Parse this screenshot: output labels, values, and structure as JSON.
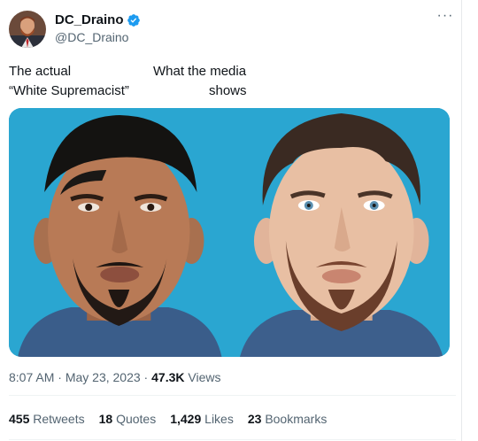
{
  "author": {
    "display_name": "DC_Draino",
    "handle": "@DC_Draino",
    "verified": true,
    "verified_color": "#1d9bf0",
    "avatar_icon": "profile-photo"
  },
  "more_icon": "more-options-icon",
  "tweet": {
    "line1_left": "The actual",
    "line2_left": "“White Supremacist”",
    "line1_right": "What the media",
    "line2_right": "shows"
  },
  "media": {
    "background": "#2aa6d1",
    "left_photo": "mugshot-photo-left",
    "right_photo": "mugshot-photo-right"
  },
  "meta": {
    "time": "8:07 AM",
    "separator": " · ",
    "date": "May 23, 2023",
    "views_count": "47.3K",
    "views_label": "Views"
  },
  "stats": [
    {
      "count": "455",
      "label": "Retweets"
    },
    {
      "count": "18",
      "label": "Quotes"
    },
    {
      "count": "1,429",
      "label": "Likes"
    },
    {
      "count": "23",
      "label": "Bookmarks"
    }
  ]
}
